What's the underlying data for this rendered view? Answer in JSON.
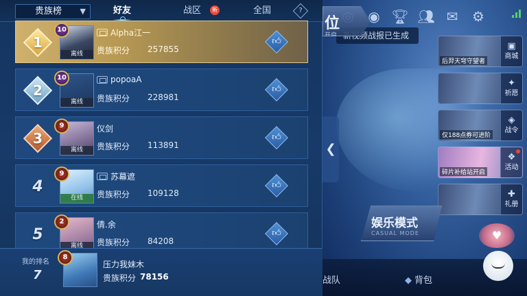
{
  "panel": {
    "dropdown_label": "贵族榜",
    "tabs": [
      {
        "label": "好友",
        "active": true
      },
      {
        "label": "战区",
        "active": false,
        "badge": "新"
      },
      {
        "label": "全国",
        "active": false
      }
    ],
    "help_label": "?"
  },
  "leaderboard": {
    "score_label": "贵族积分",
    "rows": [
      {
        "rank": "1",
        "level": "10",
        "name": "Alpha江一",
        "status": "离线",
        "score": "257855",
        "qq": true
      },
      {
        "rank": "2",
        "level": "10",
        "name": "popoaA",
        "status": "离线",
        "score": "228981",
        "qq": true
      },
      {
        "rank": "3",
        "level": "9",
        "name": "仪剑",
        "status": "离线",
        "score": "113891",
        "qq": false
      },
      {
        "rank": "4",
        "level": "9",
        "name": "苏幕遮",
        "status": "在线",
        "score": "109128",
        "qq": true
      },
      {
        "rank": "5",
        "level": "2",
        "name": "倩.余",
        "status": "离线",
        "score": "84208",
        "qq": false
      }
    ]
  },
  "my_rank": {
    "label": "我的排名",
    "rank": "7",
    "level": "8",
    "name": "压力我妹木",
    "score_label": "贵族积分",
    "score": "78156"
  },
  "lobby": {
    "toast": "新视频战报已生成",
    "side_cards": [
      {
        "caption": "后羿天穹守望者",
        "button": "商城",
        "icon": "shop-icon",
        "dot": false
      },
      {
        "caption": "",
        "button": "祈愿",
        "icon": "wish-icon",
        "dot": false
      },
      {
        "caption": "仅188点券可进阶",
        "button": "战令",
        "icon": "battlepass-icon",
        "dot": false
      },
      {
        "caption": "碎片补给站开启",
        "button": "活动",
        "icon": "event-icon",
        "dot": true
      },
      {
        "caption": "",
        "button": "礼册",
        "icon": "giftbook-icon",
        "dot": false
      }
    ],
    "rank_mode": {
      "label": "位",
      "sub": "开启"
    },
    "casual_mode": {
      "label": "娱乐模式",
      "sub": "CASUAL MODE"
    },
    "bottom_items": [
      {
        "label": "战队",
        "icon": "team-icon"
      },
      {
        "label": "背包",
        "icon": "backpack-icon"
      }
    ]
  },
  "colors": {
    "panel_bg": "#173a6a",
    "gold_row": "#b79954",
    "online": "#2f8a46",
    "new_badge": "#e84b3c"
  }
}
